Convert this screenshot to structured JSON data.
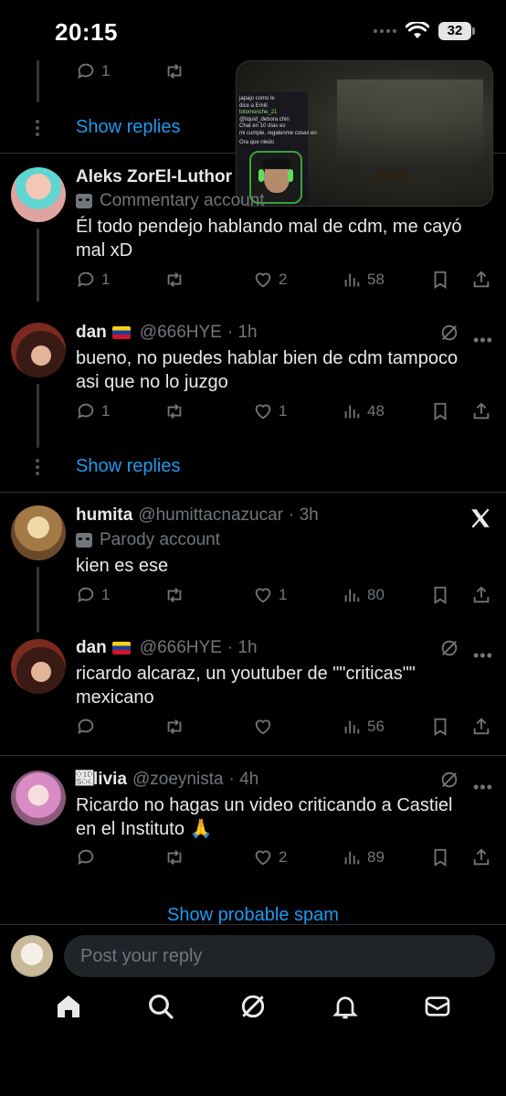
{
  "status_bar": {
    "time": "20:15",
    "battery": "32"
  },
  "top_stub": {
    "reply_count": "1",
    "show_replies": "Show replies"
  },
  "stream_overlay": {
    "chat": [
      "japajo como le",
      "dice a Emili",
      "totomonche_21",
      "@liquid_debora chin",
      "Chat en 10 días es",
      "mi cumple, regalenme cosas en",
      "Ora que niedo"
    ]
  },
  "replies": [
    {
      "name": "Aleks ZorEl-Luthor",
      "label": "Commentary account",
      "text": "Él todo pendejo hablando mal de cdm, me cayó mal xD",
      "replies": "1",
      "retweets": "",
      "likes": "2",
      "views": "58"
    },
    {
      "name": "dan",
      "handle": "@666HYE",
      "time": "· 1h",
      "text": "bueno, no puedes hablar bien de cdm tampoco asi que no lo juzgo",
      "replies": "1",
      "retweets": "",
      "likes": "1",
      "views": "48"
    },
    {
      "name": "humita",
      "handle": "@humittacnazucar",
      "time": "· 3h",
      "label": "Parody account",
      "text": "kien es ese",
      "replies": "1",
      "retweets": "",
      "likes": "1",
      "views": "80"
    },
    {
      "name": "dan",
      "handle": "@666HYE",
      "time": "· 1h",
      "text": "ricardo alcaraz, un youtuber de \"\"criticas\"\" mexicano",
      "replies": "",
      "retweets": "",
      "likes": "",
      "views": "56"
    },
    {
      "name": "𝔆livia",
      "handle": "@zoeynista",
      "time": "· 4h",
      "text": "Ricardo no hagas un video criticando a Castiel en el Instituto 🙏",
      "replies": "",
      "retweets": "",
      "likes": "2",
      "views": "89"
    }
  ],
  "show_replies": "Show replies",
  "show_spam": "Show probable spam",
  "reply_placeholder": "Post your reply",
  "colors": {
    "accent": "#1d9bf0",
    "background": "#000000",
    "muted": "#71767b"
  }
}
